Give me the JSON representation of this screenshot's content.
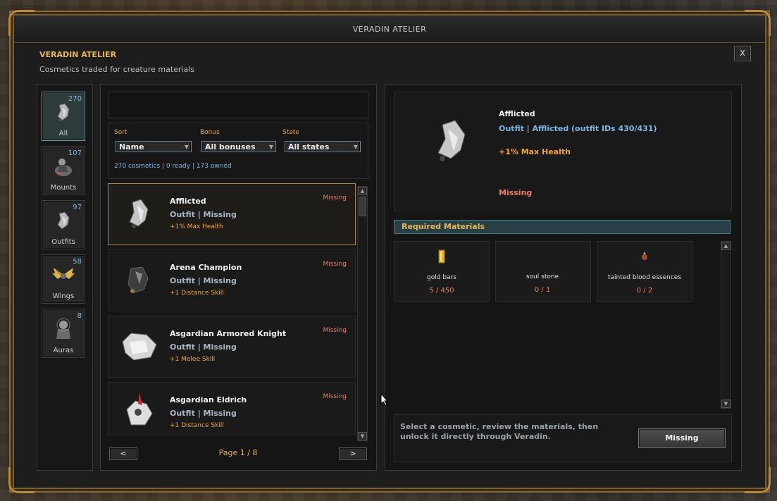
{
  "window": {
    "titlebar_text": "VERADIN ATELIER",
    "header_title": "VERADIN ATELIER",
    "header_subtitle": "Cosmetics traded for creature materials",
    "close_label": "X"
  },
  "categories": [
    {
      "label": "All",
      "count": "270",
      "icon": "outfit-icon",
      "active": true
    },
    {
      "label": "Mounts",
      "count": "107",
      "icon": "mount-icon",
      "active": false
    },
    {
      "label": "Outfits",
      "count": "97",
      "icon": "outfit-icon",
      "active": false
    },
    {
      "label": "Wings",
      "count": "58",
      "icon": "wings-icon",
      "active": false
    },
    {
      "label": "Auras",
      "count": "8",
      "icon": "aura-icon",
      "active": false
    }
  ],
  "filters": {
    "sort_label": "Sort",
    "sort_value": "Name",
    "bonus_label": "Bonus",
    "bonus_value": "All bonuses",
    "state_label": "State",
    "state_value": "All states",
    "summary": "270 cosmetics | 0 ready | 173 owned"
  },
  "list": {
    "items": [
      {
        "name": "Afflicted",
        "type": "Outfit",
        "separator": " | ",
        "state_text": "Missing",
        "bonus": "+1% Max Health",
        "state": "Missing",
        "selected": true
      },
      {
        "name": "Arena Champion",
        "type": "Outfit",
        "separator": " | ",
        "state_text": "Missing",
        "bonus": "+1 Distance Skill",
        "state": "Missing",
        "selected": false
      },
      {
        "name": "Asgardian Armored Knight",
        "type": "Outfit",
        "separator": " | ",
        "state_text": "Missing",
        "bonus": "+1 Melee Skill",
        "state": "Missing",
        "selected": false
      },
      {
        "name": "Asgardian Eldrich",
        "type": "Outfit",
        "separator": " | ",
        "state_text": "Missing",
        "bonus": "+1 Distance Skill",
        "state": "Missing",
        "selected": false
      }
    ],
    "prev_label": "<",
    "next_label": ">",
    "page_text": "Page  1  /  8"
  },
  "detail": {
    "name": "Afflicted",
    "type_line": "Outfit  |  Afflicted (outfit IDs 430/431)",
    "bonus": "+1% Max Health",
    "state": "Missing",
    "required_header": "Required Materials",
    "materials": [
      {
        "name": "gold bars",
        "progress": "5 / 450",
        "icon": "gold-bar-icon"
      },
      {
        "name": "soul stone",
        "progress": "0 / 1",
        "icon": "soul-stone-icon"
      },
      {
        "name": "tainted blood essences",
        "progress": "0 / 2",
        "icon": "blood-essence-icon"
      }
    ],
    "hint": "Select a cosmetic, review the materials, then unlock it directly through Veradin.",
    "action_label": "Missing"
  },
  "colors": {
    "accent_gold": "#e8b653",
    "info_blue": "#7fb5e2",
    "missing_red": "#ef7b5e",
    "bonus_orange": "#f0a640"
  }
}
